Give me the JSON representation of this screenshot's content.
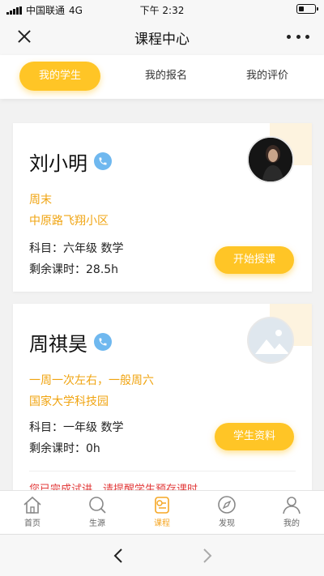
{
  "status_bar": {
    "carrier": "中国联通",
    "network": "4G",
    "time": "下午 2:32"
  },
  "nav": {
    "title": "课程中心"
  },
  "tabs": [
    {
      "label": "我的学生",
      "active": true
    },
    {
      "label": "我的报名",
      "active": false
    },
    {
      "label": "我的评价",
      "active": false
    }
  ],
  "students": [
    {
      "name": "刘小明",
      "schedule": "周末",
      "location": "中原路飞翔小区",
      "subject": "科目：六年级 数学",
      "remaining": "剩余课时：28.5h",
      "action": "开始授课"
    },
    {
      "name": "周祺昊",
      "schedule": "一周一次左右，一般周六",
      "location": "国家大学科技园",
      "subject": "科目：一年级 数学",
      "remaining": "剩余课时：0h",
      "action": "学生资料",
      "notice": "您已完成试讲，请提醒学生预存课时"
    }
  ],
  "tabbar": [
    {
      "label": "首页",
      "icon": "home-icon"
    },
    {
      "label": "生源",
      "icon": "search-icon"
    },
    {
      "label": "课程",
      "icon": "course-icon",
      "active": true
    },
    {
      "label": "发现",
      "icon": "compass-icon"
    },
    {
      "label": "我的",
      "icon": "profile-icon"
    }
  ],
  "colors": {
    "accent": "#ffc526",
    "highlight_text": "#f0a411",
    "notice": "#e23a3a",
    "phone": "#6fb8ef"
  }
}
